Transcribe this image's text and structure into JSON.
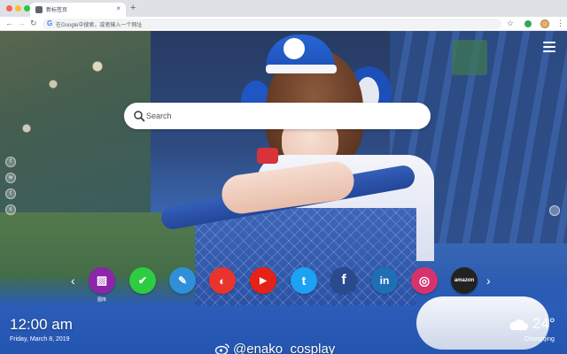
{
  "browser": {
    "tab_title": "新标签页",
    "tab_close_glyph": "×",
    "new_tab_glyph": "+",
    "omnibox_placeholder": "在Google中搜索，或者输入一个网址",
    "omnibox_logo": "G",
    "nav_back_glyph": "←",
    "nav_forward_glyph": "→",
    "nav_reload_glyph": "↻",
    "star_glyph": "☆",
    "menu_glyph": "⋮"
  },
  "search": {
    "placeholder": "Search"
  },
  "left_rail": [
    {
      "icon": "facebook-icon",
      "glyph": "f"
    },
    {
      "icon": "weibo-icon",
      "glyph": "w"
    },
    {
      "icon": "twitter-icon",
      "glyph": "t"
    },
    {
      "icon": "wechat-icon",
      "glyph": "c"
    }
  ],
  "dock": {
    "prev_glyph": "‹",
    "next_glyph": "›",
    "items": [
      {
        "icon": "gallery-icon",
        "color": "#8e24aa",
        "glyph": "▨",
        "label": "图库"
      },
      {
        "icon": "tasks-icon",
        "color": "#2ecc40",
        "glyph": "✔",
        "label": ""
      },
      {
        "icon": "notes-icon",
        "color": "#2f8fd8",
        "glyph": "✎",
        "label": ""
      },
      {
        "icon": "games-icon",
        "color": "#e8332f",
        "glyph": "◐",
        "label": ""
      },
      {
        "icon": "youtube-icon",
        "color": "#e62117",
        "glyph": "▶",
        "label": ""
      },
      {
        "icon": "twitter-icon",
        "color": "#1da1f2",
        "glyph": "t",
        "label": ""
      },
      {
        "icon": "facebook-icon",
        "color": "#2a4a8e",
        "glyph": "f",
        "label": ""
      },
      {
        "icon": "linkedin-icon",
        "color": "#1f6fb5",
        "glyph": "in",
        "label": ""
      },
      {
        "icon": "instagram-icon",
        "color": "#d6336c",
        "glyph": "◎",
        "label": ""
      },
      {
        "icon": "amazon-icon",
        "color": "#222222",
        "glyph": "amazon",
        "label": ""
      }
    ]
  },
  "clock": {
    "time": "12:00 am",
    "date": "Friday, March 8, 2019"
  },
  "credit": {
    "text": "@enako_cosplay"
  },
  "weather": {
    "temp": "24°",
    "city": "Chongqing"
  }
}
